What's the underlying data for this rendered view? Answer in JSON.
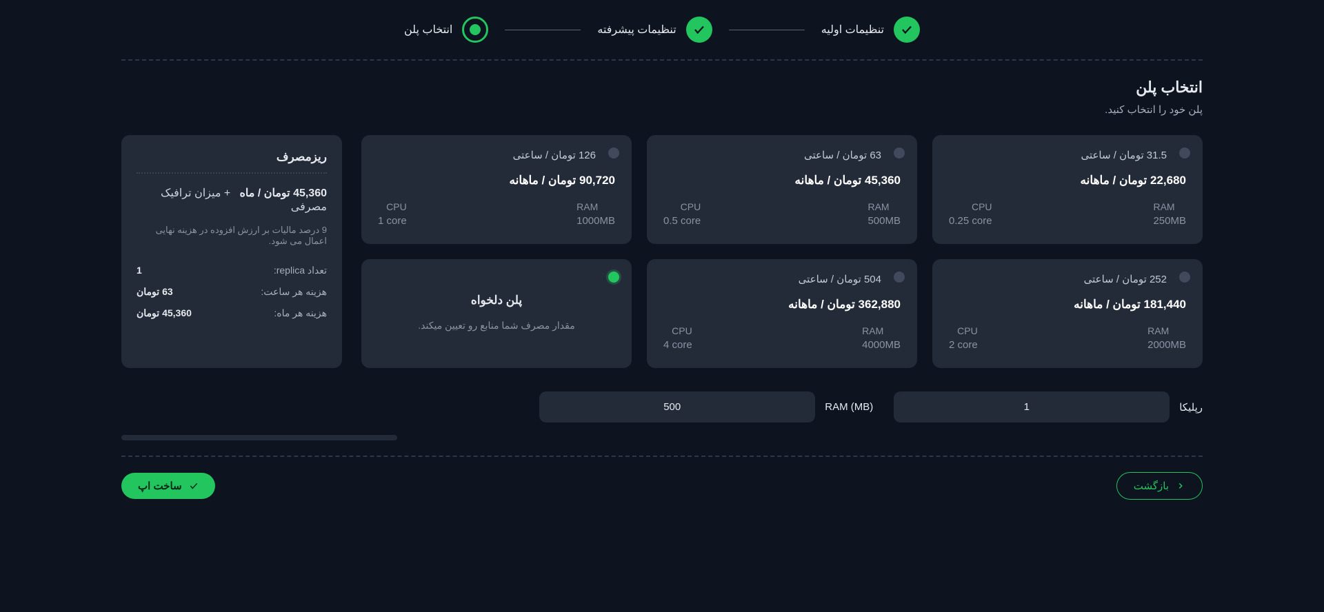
{
  "stepper": {
    "step1": "تنظیمات اولیه",
    "step2": "تنظیمات پیشرفته",
    "step3": "انتخاب پلن"
  },
  "heading": {
    "title": "انتخاب پلن",
    "subtitle": "پلن خود را انتخاب کنید."
  },
  "plans": [
    {
      "hourly": "31.5 تومان / ساعتی",
      "monthly": "22,680 تومان / ماهانه",
      "ram_label": "RAM",
      "ram": "250MB",
      "cpu_label": "CPU",
      "cpu": "0.25 core"
    },
    {
      "hourly": "63 تومان / ساعتی",
      "monthly": "45,360 تومان / ماهانه",
      "ram_label": "RAM",
      "ram": "500MB",
      "cpu_label": "CPU",
      "cpu": "0.5 core"
    },
    {
      "hourly": "126 تومان / ساعتی",
      "monthly": "90,720 تومان / ماهانه",
      "ram_label": "RAM",
      "ram": "1000MB",
      "cpu_label": "CPU",
      "cpu": "1 core"
    },
    {
      "hourly": "252 تومان / ساعتی",
      "monthly": "181,440 تومان / ماهانه",
      "ram_label": "RAM",
      "ram": "2000MB",
      "cpu_label": "CPU",
      "cpu": "2 core"
    },
    {
      "hourly": "504 تومان / ساعتی",
      "monthly": "362,880 تومان / ماهانه",
      "ram_label": "RAM",
      "ram": "4000MB",
      "cpu_label": "CPU",
      "cpu": "4 core"
    }
  ],
  "custom_plan": {
    "title": "پلن دلخواه",
    "desc": "مقدار مصرف شما منابع رو تعیین میکند."
  },
  "summary": {
    "title": "ریزمصرف",
    "main_price": "45,360 تومان / ماه",
    "plus_text": "+  میزان ترافیک مصرفی",
    "tax_note": "9 درصد مالیات بر ارزش افزوده در هزینه نهایی اعمال می شود.",
    "row_replica_k": "تعداد replica:",
    "row_replica_v": "1",
    "row_hour_k": "هزینه هر ساعت:",
    "row_hour_v": "63 تومان",
    "row_month_k": "هزینه هر ماه:",
    "row_month_v": "45,360 تومان"
  },
  "inputs": {
    "replica_label": "رپلیکا",
    "replica_value": "1",
    "ram_label": "RAM (MB)",
    "ram_value": "500"
  },
  "footer": {
    "back": "بازگشت",
    "create": "ساخت اپ"
  }
}
